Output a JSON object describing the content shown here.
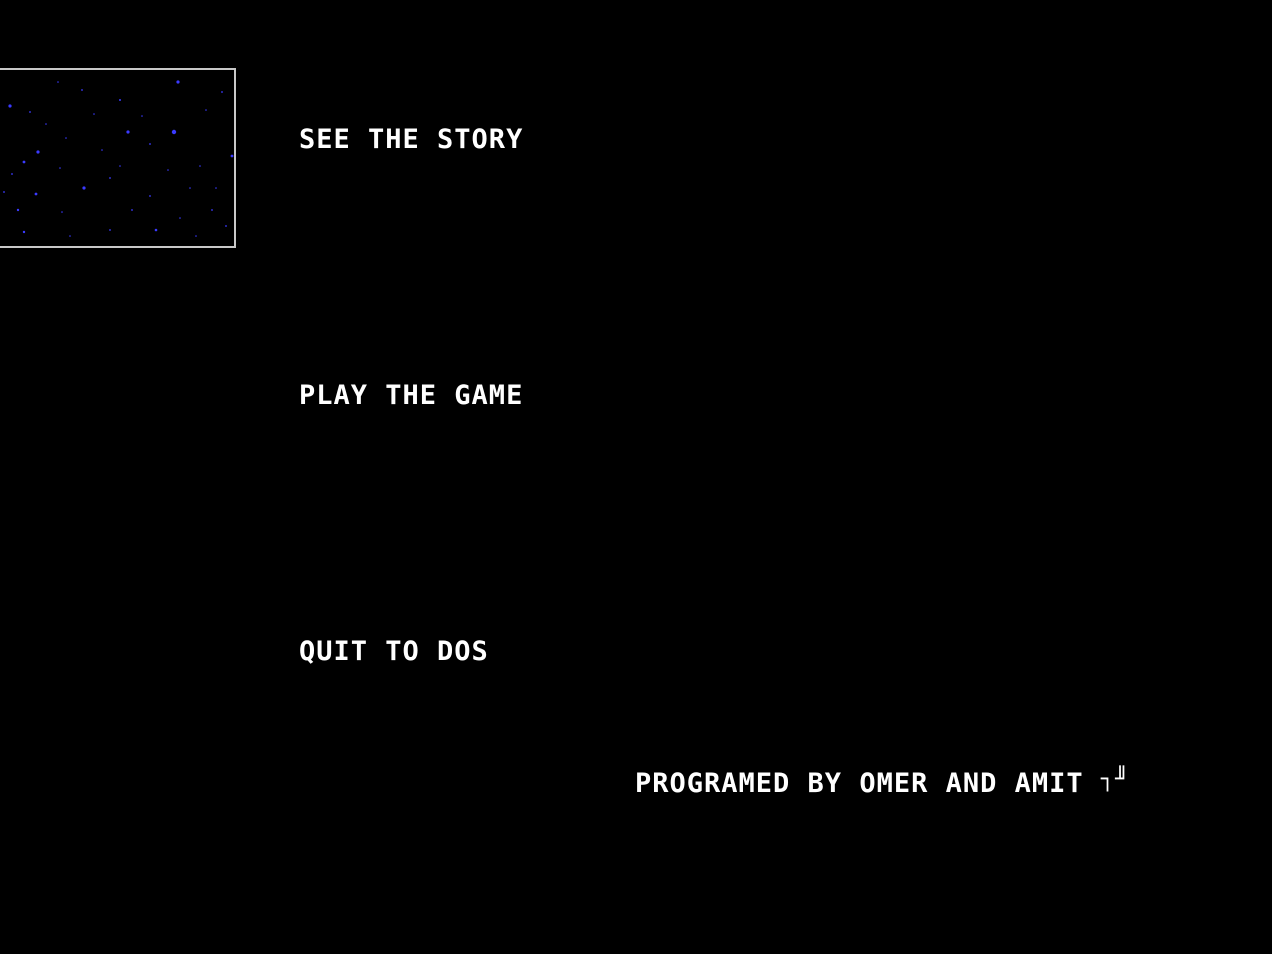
{
  "colors": {
    "background": "#000000",
    "text": "#ffffff",
    "star": "#3a3aff",
    "frame_border": "#c8c8c8"
  },
  "preview": {
    "type": "starfield-animation"
  },
  "menu": {
    "items": [
      {
        "id": "story",
        "label": "SEE THE STORY"
      },
      {
        "id": "play",
        "label": "PLAY THE GAME"
      },
      {
        "id": "quit",
        "label": "QUIT TO DOS"
      }
    ]
  },
  "credits": {
    "text": "PROGRAMED BY OMER AND AMIT",
    "glyph": "┐╜"
  }
}
